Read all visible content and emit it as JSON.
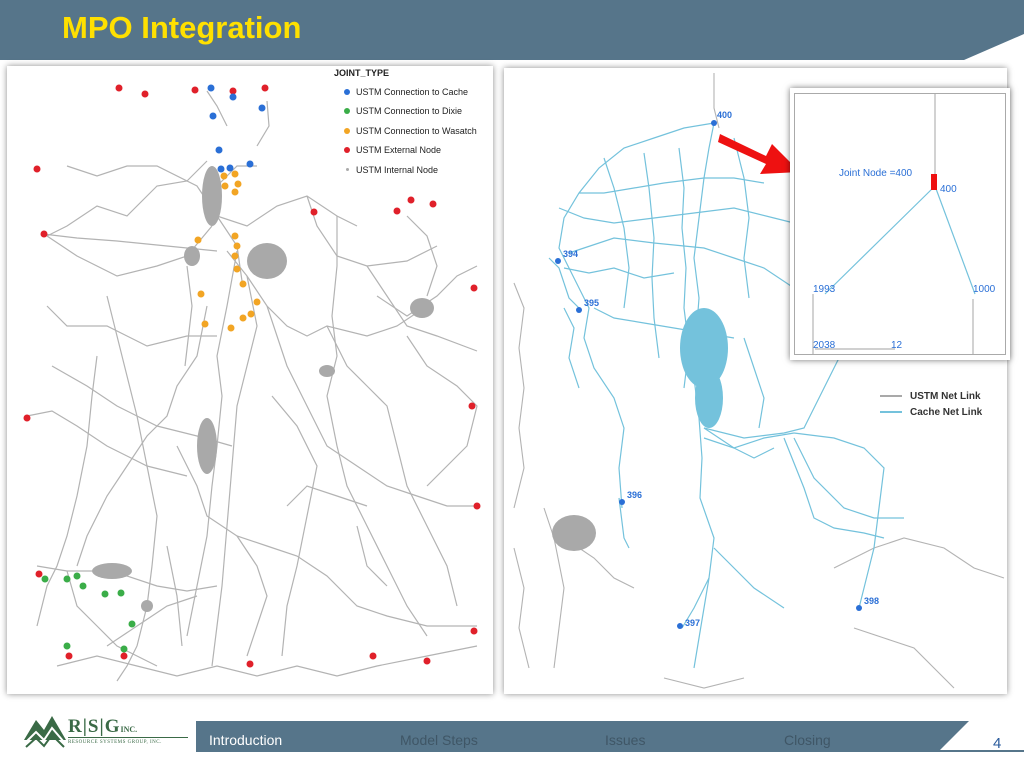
{
  "header": {
    "title": "MPO Integration"
  },
  "legend": {
    "title": "JOINT_TYPE",
    "items": [
      {
        "label": "USTM Connection to Cache",
        "color": "#2a6fd6"
      },
      {
        "label": "USTM Connection to Dixie",
        "color": "#3aad48"
      },
      {
        "label": "USTM Connection to Wasatch",
        "color": "#f2a524"
      },
      {
        "label": "USTM External Node",
        "color": "#e0202a"
      },
      {
        "label": "USTM Internal Node",
        "color": "#aaaaaa"
      }
    ]
  },
  "right_map": {
    "node_labels": [
      "400",
      "394",
      "395",
      "396",
      "397",
      "398"
    ],
    "inset": {
      "caption": "Joint Node =400",
      "labels": [
        "400",
        "1993",
        "1000",
        "2038",
        "12"
      ]
    },
    "legend": [
      {
        "label": "USTM Net Link",
        "color": "#a9a9a9"
      },
      {
        "label": "Cache Net Link",
        "color": "#74c2dc"
      }
    ]
  },
  "footer": {
    "logo_letters": [
      "R",
      "S",
      "G"
    ],
    "logo_inc": "INC.",
    "logo_sub": "RESOURCE SYSTEMS GROUP, INC.",
    "nav": [
      {
        "label": "Introduction",
        "active": true
      },
      {
        "label": "Model Steps",
        "active": false
      },
      {
        "label": "Issues",
        "active": false
      },
      {
        "label": "Closing",
        "active": false
      }
    ],
    "page_number": "4"
  }
}
